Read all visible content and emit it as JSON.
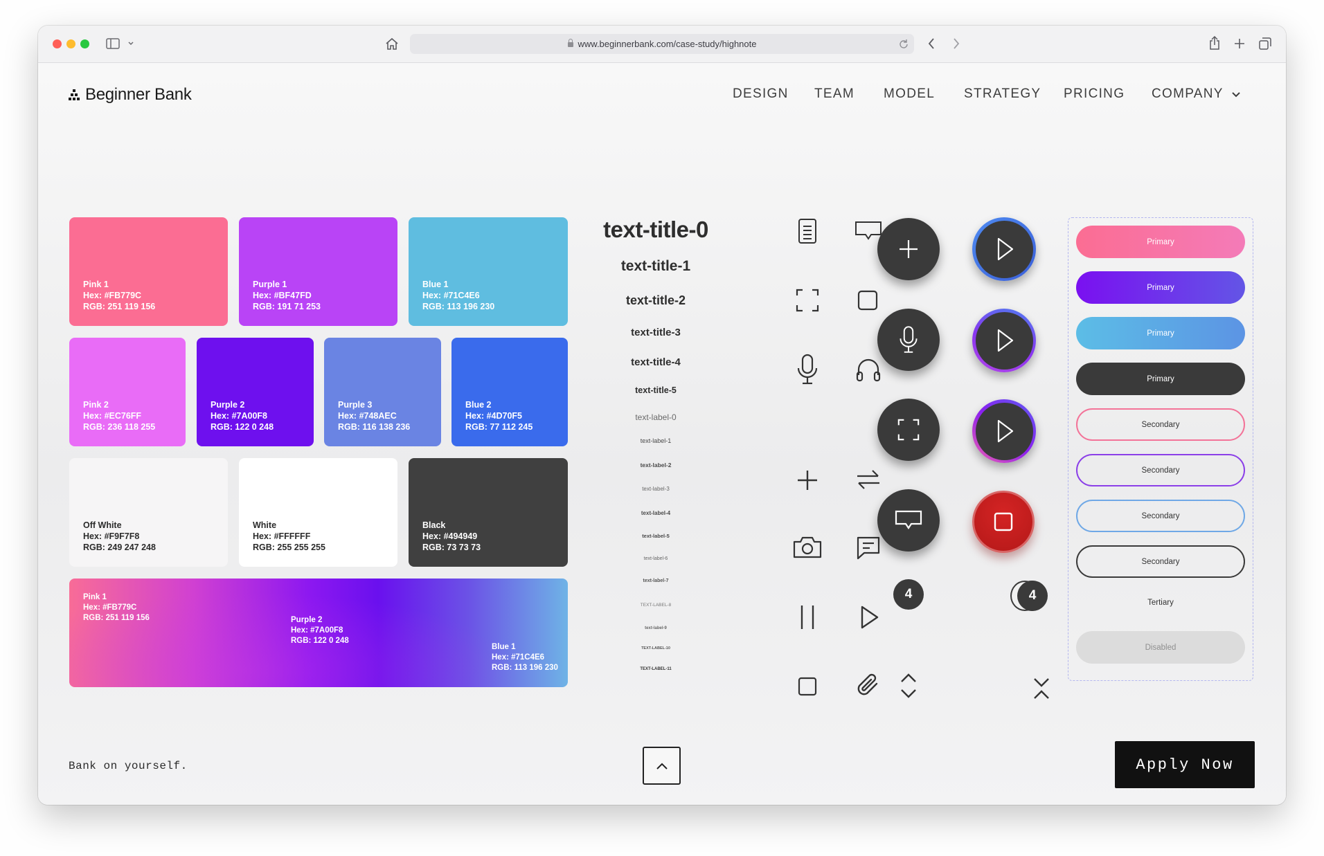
{
  "browser": {
    "url": "www.beginnerbank.com/case-study/highnote"
  },
  "site": {
    "logo": "Beginner Bank",
    "nav": [
      "DESIGN",
      "TEAM",
      "MODEL",
      "STRATEGY",
      "PRICING",
      "COMPANY"
    ]
  },
  "swatches": [
    {
      "name": "Pink 1",
      "hex": "Hex: #FB779C",
      "rgb": "RGB: 251 119 156",
      "color": "#FB6D93"
    },
    {
      "name": "Purple 1",
      "hex": "Hex: #BF47FD",
      "rgb": "RGB: 191 71 253",
      "color": "#B944F6"
    },
    {
      "name": "Blue 1",
      "hex": "Hex: #71C4E6",
      "rgb": "RGB: 113 196 230",
      "color": "#5FBDE0"
    },
    {
      "name": "Pink 2",
      "hex": "Hex: #EC76FF",
      "rgb": "RGB: 236 118 255",
      "color": "#E96CF7"
    },
    {
      "name": "Purple 2",
      "hex": "Hex: #7A00F8",
      "rgb": "RGB: 122 0 248",
      "color": "#6E10EE"
    },
    {
      "name": "Purple 3",
      "hex": "Hex: #748AEC",
      "rgb": "RGB: 116 138 236",
      "color": "#6A84E3"
    },
    {
      "name": "Blue 2",
      "hex": "Hex: #4D70F5",
      "rgb": "RGB: 77 112 245",
      "color": "#3A6BEC"
    },
    {
      "name": "Off White",
      "hex": "Hex: #F9F7F8",
      "rgb": "RGB: 249 247 248",
      "color": "#F6F5F6"
    },
    {
      "name": "White",
      "hex": "Hex: #FFFFFF",
      "rgb": "RGB: 255 255 255",
      "color": "#FFFFFF"
    },
    {
      "name": "Black",
      "hex": "Hex: #494949",
      "rgb": "RGB: 73 73 73",
      "color": "#404040"
    }
  ],
  "gradient": {
    "stops": [
      {
        "name": "Pink 1",
        "hex": "Hex: #FB779C",
        "rgb": "RGB: 251 119 156"
      },
      {
        "name": "Purple 2",
        "hex": "Hex: #7A00F8",
        "rgb": "RGB: 122 0 248"
      },
      {
        "name": "Blue 1",
        "hex": "Hex: #71C4E6",
        "rgb": "RGB: 113 196 230"
      }
    ]
  },
  "type_scale": [
    "text-title-0",
    "text-title-1",
    "text-title-2",
    "text-title-3",
    "text-title-4",
    "text-title-5",
    "text-label-0",
    "text-label-1",
    "text-label-2",
    "text-label-3",
    "text-label-4",
    "text-label-5",
    "text-label-6",
    "text-label-7",
    "TEXT-LABEL-8",
    "text-label-9",
    "TEXT-LABEL-10",
    "TEXT-LABEL-11"
  ],
  "icons": [
    "document-icon",
    "chat-bubble-icon",
    "fullscreen-icon",
    "square-icon",
    "microphone-icon",
    "headphones-icon",
    "plus-icon",
    "swap-arrows-icon",
    "camera-icon",
    "message-icon",
    "pause-icon",
    "play-icon",
    "stop-icon",
    "paperclip-icon"
  ],
  "badges": {
    "count": "4",
    "stack_count": "4"
  },
  "buttons": {
    "primary": [
      "Primary",
      "Primary",
      "Primary",
      "Primary"
    ],
    "secondary": [
      "Secondary",
      "Secondary",
      "Secondary",
      "Secondary"
    ],
    "tertiary": "Tertiary",
    "disabled": "Disabled"
  },
  "footer": {
    "tagline": "Bank on yourself.",
    "cta": "Apply Now"
  },
  "colors": {
    "accent_pink": "#FB779C",
    "accent_purple": "#7A00F8",
    "accent_blue": "#71C4E6",
    "stop_red": "#C41E1E"
  }
}
